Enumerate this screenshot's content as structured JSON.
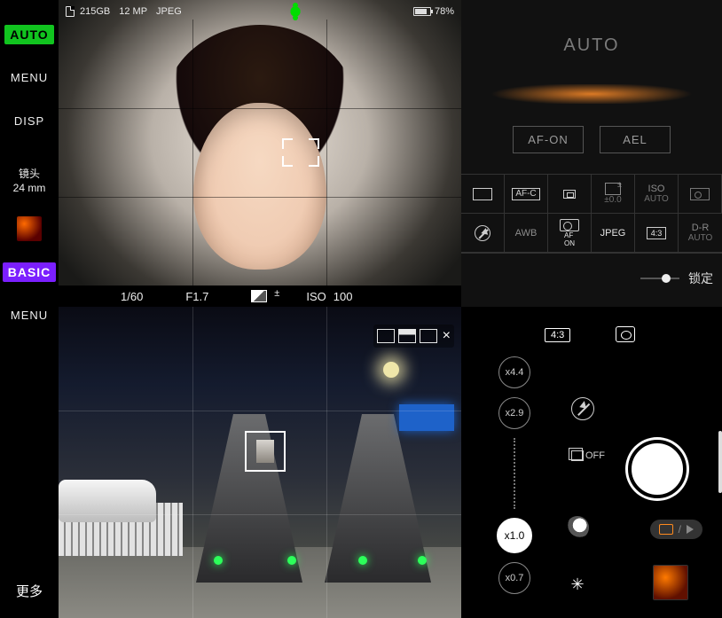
{
  "status": {
    "storage": "215GB",
    "resolution": "12 MP",
    "file_format": "JPEG",
    "battery_pct": "78%"
  },
  "left_toolbar": {
    "auto_badge": "AUTO",
    "menu": "MENU",
    "disp": "DISP",
    "lens_label": "镜头",
    "lens_focal": "24 mm",
    "basic_badge": "BASIC",
    "menu2": "MENU",
    "more": "更多"
  },
  "vf1_info": {
    "shutter": "1/60",
    "aperture": "F1.7",
    "iso_label": "ISO",
    "iso_value": "100"
  },
  "panel_a": {
    "title": "AUTO",
    "af_on": "AF-ON",
    "ael": "AEL",
    "row1": {
      "afc": "AF-C",
      "ev_value": "±0.0",
      "iso_label": "ISO",
      "iso_value": "AUTO"
    },
    "row2": {
      "awb": "AWB",
      "face_af_top": "AF",
      "face_af_bottom": "ON",
      "format": "JPEG",
      "ratio": "4:3",
      "dr_label": "D-R",
      "dr_value": "AUTO"
    },
    "lock_label": "锁定"
  },
  "panel_b": {
    "aspect_chip": "4:3",
    "zoom": {
      "x44": "x4.4",
      "x29": "x2.9",
      "x10": "x1.0",
      "x07": "x0.7"
    },
    "drive_off": "OFF",
    "color_glyph": "✳"
  }
}
